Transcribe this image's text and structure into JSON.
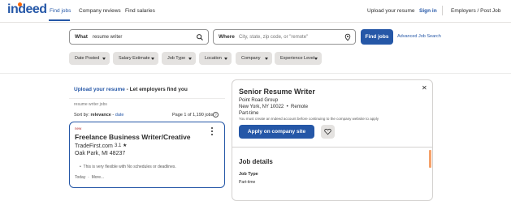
{
  "brand": {
    "logo_text": "indeed",
    "accent": "#2557a7",
    "dot_color": "#ff6600"
  },
  "nav": {
    "find_jobs": "Find jobs",
    "company_reviews": "Company reviews",
    "find_salaries": "Find salaries",
    "upload_resume": "Upload your resume",
    "sign_in": "Sign in",
    "employers": "Employers / Post Job"
  },
  "search": {
    "what_label": "What",
    "what_value": "resume writer",
    "where_label": "Where",
    "where_placeholder": "City, state, zip code, or \"remote\"",
    "find_button": "Find jobs",
    "advanced_link": "Advanced Job Search"
  },
  "filters": [
    "Date Posted",
    "Salary Estimate",
    "Job Type",
    "Location",
    "Company",
    "Experience Level"
  ],
  "results": {
    "upload_link": "Upload your resume",
    "upload_rest": " - Let employers find you",
    "query_caption": "resume writer jobs",
    "sort_prefix": "Sort by: ",
    "sort_current": "relevance",
    "sort_sep": " - ",
    "sort_alt": "date",
    "page_count": "Page 1 of 1,190 jobs"
  },
  "job_card": {
    "badge": "new",
    "title": "Freelance Business Writer/Creative",
    "company": "TradeFirst.com",
    "rating": "3.1 ★",
    "location": "Oak Park, MI 48237",
    "snippet": "This is very flexible with No schedules or deadlines.",
    "posted": "Today",
    "more": "More..."
  },
  "detail": {
    "title": "Senior Resume Writer",
    "company": "Point Road Group",
    "location": "New York, NY 10022",
    "remote": "Remote",
    "job_type": "Part-time",
    "note": "You must create an Indeed account before continuing to the company website to apply",
    "apply_button": "Apply on company site",
    "section_title": "Job details",
    "job_type_label": "Job Type",
    "job_type_value": "Part-time"
  }
}
